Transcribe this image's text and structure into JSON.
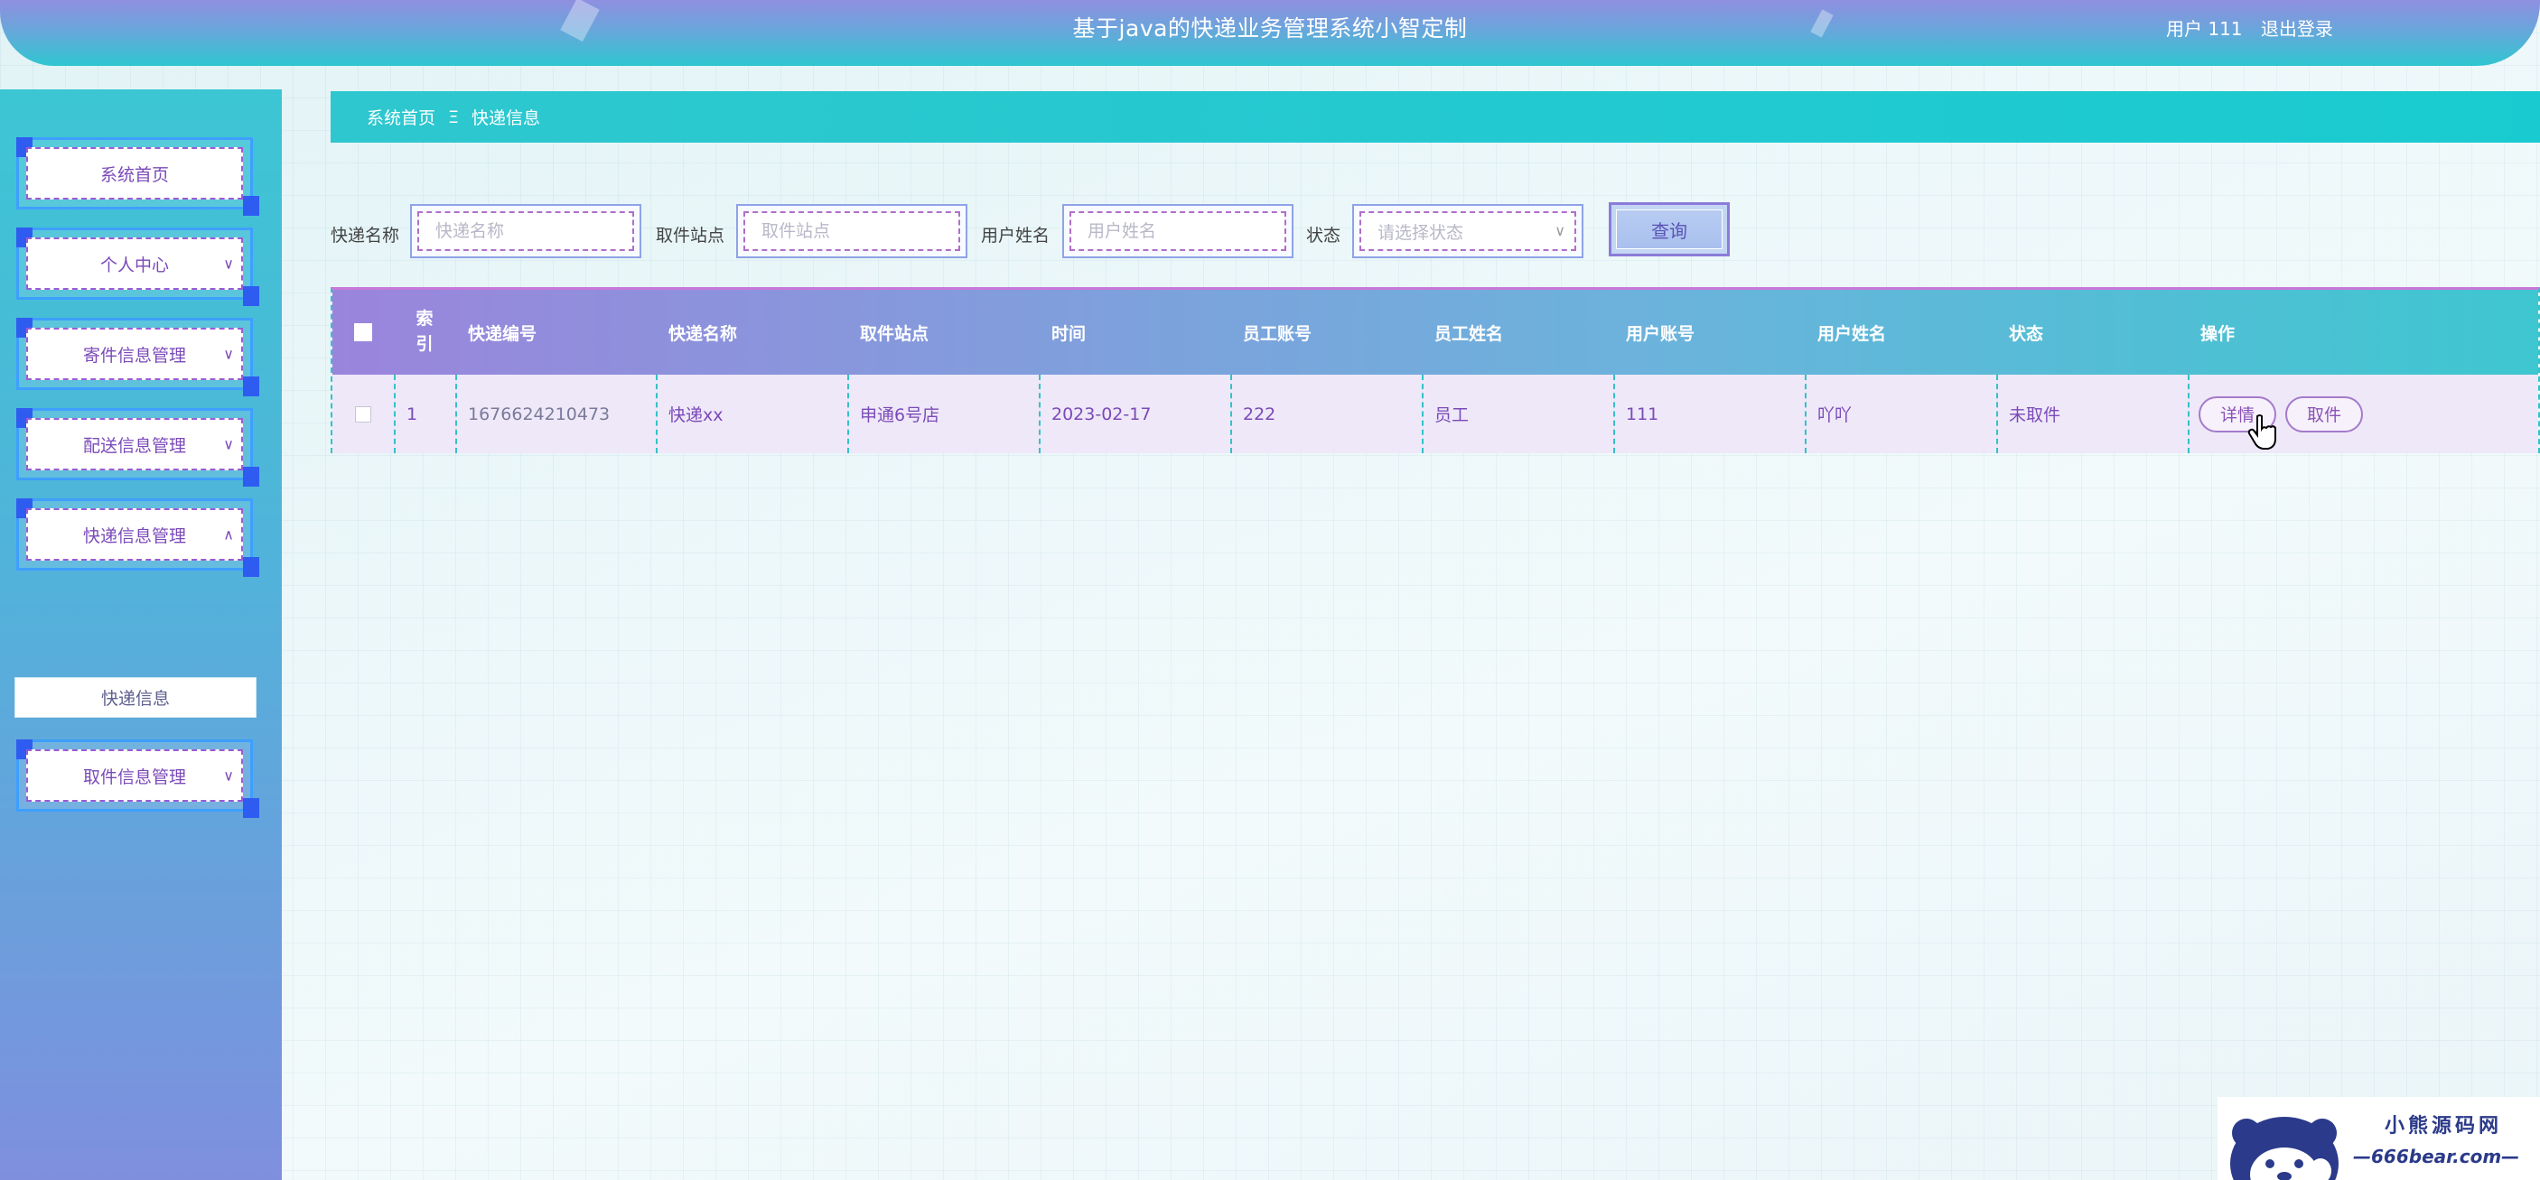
{
  "header": {
    "title": "基于java的快递业务管理系统小智定制",
    "user_label": "用户 111",
    "logout_label": "退出登录"
  },
  "sidebar": {
    "items": [
      {
        "label": "系统首页",
        "has_chevron": false
      },
      {
        "label": "个人中心",
        "has_chevron": true,
        "chevron": "down"
      },
      {
        "label": "寄件信息管理",
        "has_chevron": true,
        "chevron": "down"
      },
      {
        "label": "配送信息管理",
        "has_chevron": true,
        "chevron": "down"
      },
      {
        "label": "快递信息管理",
        "has_chevron": true,
        "chevron": "up",
        "expanded": true
      },
      {
        "label": "取件信息管理",
        "has_chevron": true,
        "chevron": "down"
      }
    ],
    "sub_item": {
      "label": "快递信息",
      "active": true
    }
  },
  "breadcrumb": {
    "home": "系统首页",
    "separator": "Ξ",
    "current": "快递信息"
  },
  "search": {
    "fields": [
      {
        "label": "快递名称",
        "placeholder": "快递名称"
      },
      {
        "label": "取件站点",
        "placeholder": "取件站点"
      },
      {
        "label": "用户姓名",
        "placeholder": "用户姓名"
      }
    ],
    "status": {
      "label": "状态",
      "placeholder": "请选择状态"
    },
    "query_button": "查询"
  },
  "table": {
    "headers": {
      "index": "索\n引",
      "express_no": "快递编号",
      "express_name": "快递名称",
      "station": "取件站点",
      "time": "时间",
      "staff_account": "员工账号",
      "staff_name": "员工姓名",
      "user_account": "用户账号",
      "user_name": "用户姓名",
      "status": "状态",
      "actions": "操作"
    },
    "rows": [
      {
        "index": "1",
        "express_no": "1676624210473",
        "express_name": "快递xx",
        "station": "申通6号店",
        "time": "2023-02-17",
        "staff_account": "222",
        "staff_name": "员工",
        "user_account": "111",
        "user_name": "吖吖",
        "status": "未取件",
        "detail_button": "详情",
        "pickup_button": "取件"
      }
    ]
  },
  "watermark": {
    "cn": "小熊源码网",
    "en": "—666bear.com—"
  },
  "colors": {
    "accent_teal": "#1ecbd0",
    "accent_purple": "#7b4ab8",
    "menu_border_blue": "#3e9fff"
  }
}
